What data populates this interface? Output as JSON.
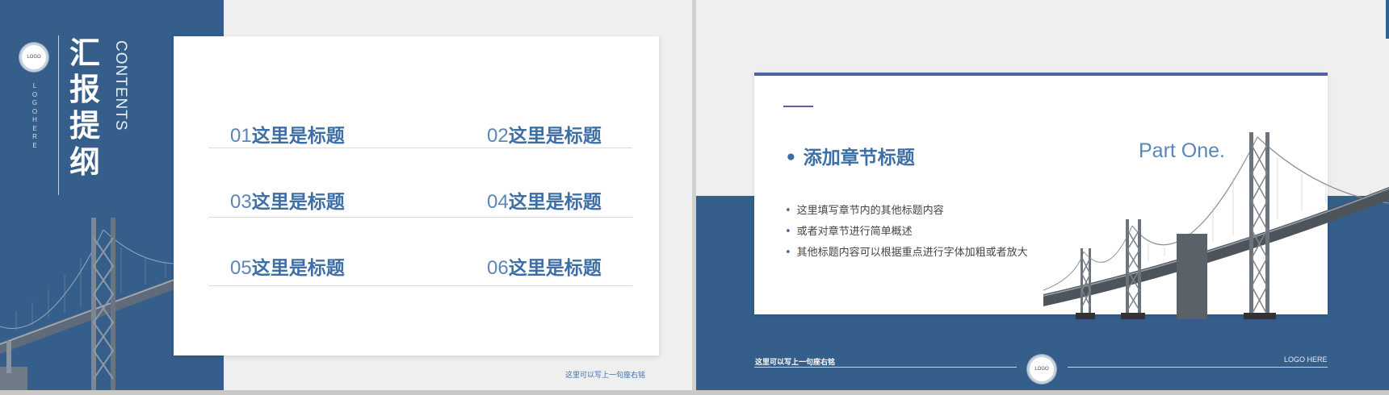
{
  "slide1": {
    "logo": "LOGO",
    "vertical_logo": "LOGOHERE",
    "title_chars": [
      "汇",
      "报",
      "提",
      "纲"
    ],
    "contents_label": "CONTENTS",
    "toc": [
      {
        "num": "01",
        "text": "这里是标题"
      },
      {
        "num": "02",
        "text": "这里是标题"
      },
      {
        "num": "03",
        "text": "这里是标题"
      },
      {
        "num": "04",
        "text": "这里是标题"
      },
      {
        "num": "05",
        "text": "这里是标题"
      },
      {
        "num": "06",
        "text": "这里是标题"
      }
    ],
    "motto": "这里可以写上一句座右铭"
  },
  "slide2": {
    "section_title": "• 添加章节标题",
    "part_label": "Part One.",
    "bullets": [
      "这里填写章节内的其他标题内容",
      "或者对章节进行简单概述",
      "其他标题内容可以根据重点进行字体加粗或者放大"
    ],
    "motto": "这里可以写上一句座右铭",
    "logo": "LOGO",
    "logo_here": "LOGO HERE"
  },
  "colors": {
    "primary_blue": "#355e8b",
    "accent_blue": "#3d6ea6",
    "card_bar": "#4e62a6",
    "background": "#efefef"
  }
}
